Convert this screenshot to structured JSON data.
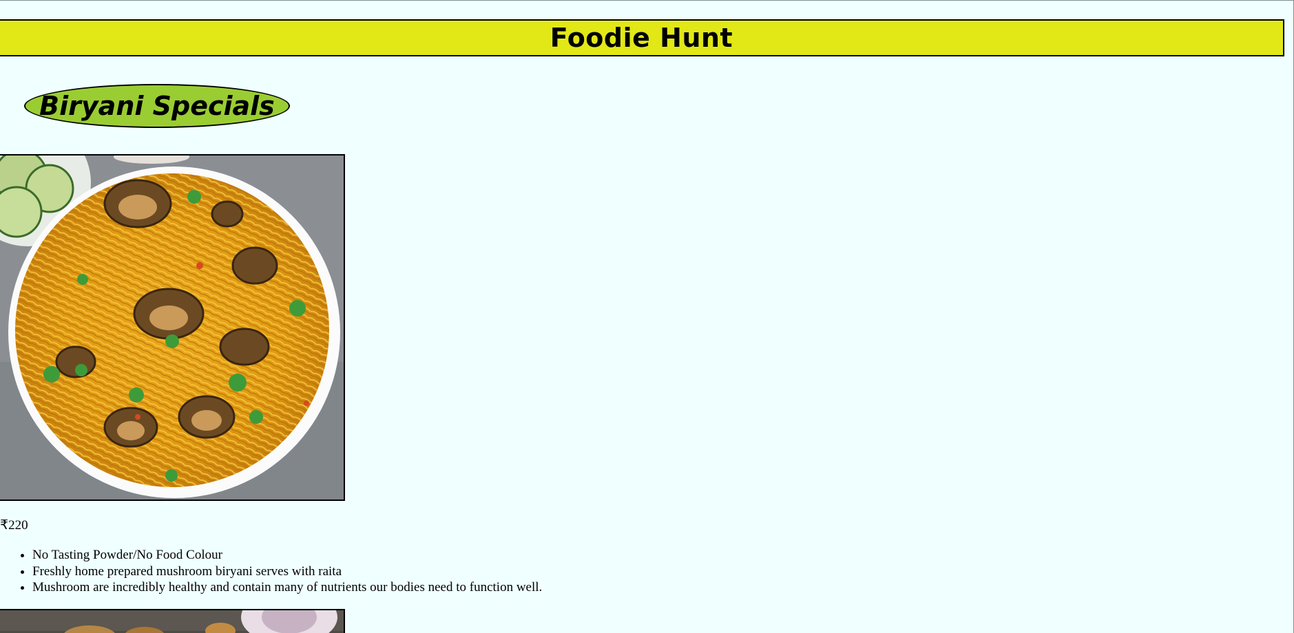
{
  "header": {
    "title": "Foodie Hunt",
    "background": "#e1e816"
  },
  "section": {
    "title": "Biryani Specials",
    "background": "#9acd32"
  },
  "items": [
    {
      "image": "mushroom-biryani-photo",
      "price": "₹220",
      "features": [
        "No Tasting Powder/No Food Colour",
        "Freshly home prepared mushroom biryani serves with raita",
        "Mushroom are incredibly healthy and contain many of nutrients our bodies need to function well."
      ]
    },
    {
      "image": "biryani-photo-partial"
    }
  ],
  "colors": {
    "page_background": "#f0ffff"
  }
}
